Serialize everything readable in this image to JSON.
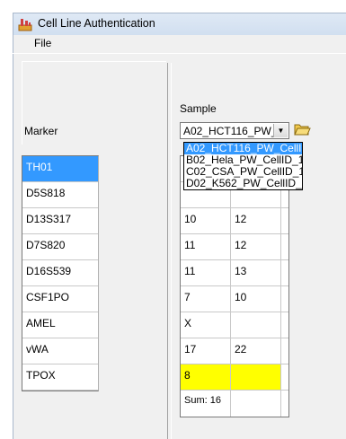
{
  "window": {
    "title": "Cell Line Authentication"
  },
  "menu": {
    "file": "File"
  },
  "marker_panel": {
    "header": "Marker",
    "markers": [
      "TH01",
      "D5S818",
      "D13S317",
      "D7S820",
      "D16S539",
      "CSF1PO",
      "AMEL",
      "vWA",
      "TPOX"
    ]
  },
  "sample_panel": {
    "label": "Sample",
    "selected": "A02_HCT116_PW_",
    "options": [
      "A02_HCT116_PW_CellI",
      "B02_Hela_PW_CellID_1",
      "C02_CSA_PW_CellID_1",
      "D02_K562_PW_CellID_"
    ],
    "rows": [
      [
        "",
        ""
      ],
      [
        "",
        ""
      ],
      [
        "10",
        "12"
      ],
      [
        "11",
        "12"
      ],
      [
        "11",
        "13"
      ],
      [
        "7",
        "10"
      ],
      [
        "X",
        ""
      ],
      [
        "17",
        "22"
      ],
      [
        "8",
        ""
      ]
    ],
    "sum": "Sum: 16"
  },
  "colors": {
    "selection": "#3399ff",
    "highlight": "#ffff00"
  },
  "icons": {
    "app": "cell-line-icon",
    "open": "folder-open-icon",
    "dropdown": "chevron-down-icon"
  }
}
